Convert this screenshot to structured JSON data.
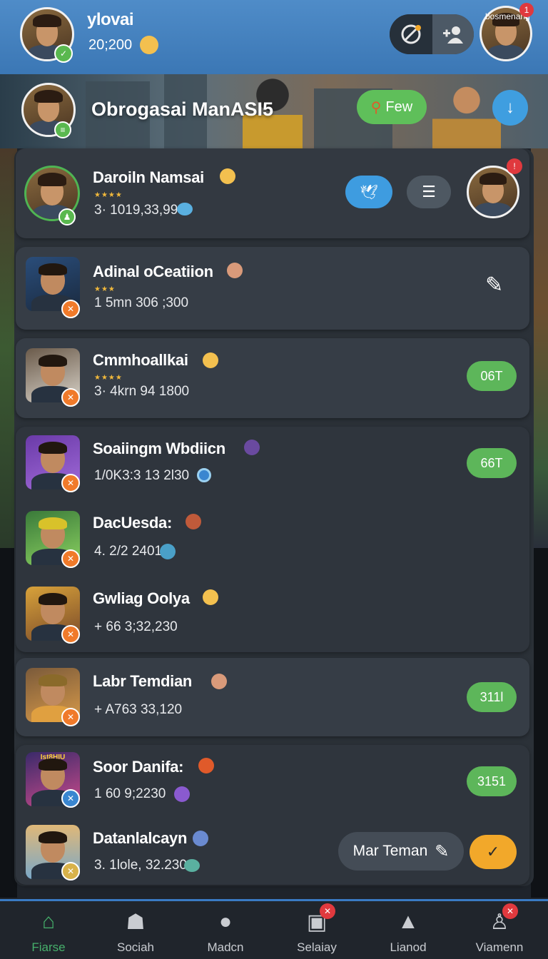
{
  "header": {
    "username": "ylovai",
    "coins": "20;200",
    "corner_label": "bosmenang",
    "notif_count": "1"
  },
  "banner": {
    "title": "Obrogasai ManASI5",
    "few_label": "Few"
  },
  "friends": [
    {
      "name": "Daroiln Namsai",
      "stars": "★★★★",
      "stat": "3· 1019,33,99"
    },
    {
      "name": "Adinal oCeatiion",
      "stars": "★★★",
      "stat": "1  5mn 306 ;300"
    },
    {
      "name": "Cmmhoallkai",
      "stars": "★★★★",
      "stat": "3· 4krn 94 1800",
      "pill": "06T"
    },
    {
      "name": "Soaiingm Wbdiicn",
      "stat": "1/0K3:3 13 2l30",
      "pill": "66T"
    },
    {
      "name": "DacUesda:",
      "stat": "4. 2/2 2401"
    },
    {
      "name": "Gwliag Oolya",
      "stat": "+ 66 3;32,230"
    },
    {
      "name": "Labr Temdian",
      "stat": "+ A763 33,120",
      "pill": "311l"
    },
    {
      "name": "Soor Danifa:",
      "stat": "1 60 9;2230",
      "pill": "3151",
      "thumb_caption": "Ist8HIU"
    },
    {
      "name": "Datanlalcayn",
      "stat": "3. 1lole, 32.230"
    }
  ],
  "actions": {
    "add_friend_label": "Mar Teman",
    "check_icon": "check-icon"
  },
  "tabs": [
    {
      "label": "Fiarse"
    },
    {
      "label": "Soсiah"
    },
    {
      "label": "Madcn"
    },
    {
      "label": "Selaiay"
    },
    {
      "label": "Lianod"
    },
    {
      "label": "Viamenn"
    }
  ],
  "colors": {
    "header_blue": "#3b77b5",
    "accent_green": "#5db65a",
    "accent_blue": "#3e9ce0",
    "accent_orange": "#f2a82a",
    "panel": "#2b3138"
  }
}
